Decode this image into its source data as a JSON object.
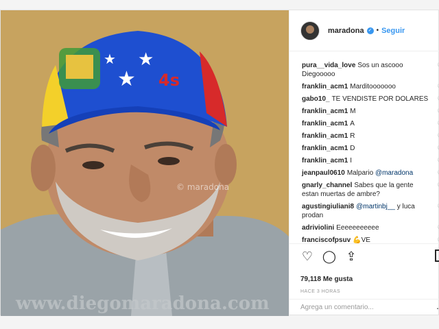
{
  "post": {
    "username": "maradona",
    "follow_label": "Seguir",
    "separator": "•",
    "verified_mark": "✓"
  },
  "photo": {
    "watermark_site": "www.diegomaradona.com",
    "watermark_handle": "© maradona"
  },
  "comments": [
    {
      "user": "pura__vida_love",
      "text": "Sos un ascooo Diegooooo"
    },
    {
      "user": "franklin_acm1",
      "text": "Marditooooooo"
    },
    {
      "user": "gabo10_",
      "text": "TE VENDISTE POR DOLARES"
    },
    {
      "user": "franklin_acm1",
      "text": "M"
    },
    {
      "user": "franklin_acm1",
      "text": "A"
    },
    {
      "user": "franklin_acm1",
      "text": "R"
    },
    {
      "user": "franklin_acm1",
      "text": "D"
    },
    {
      "user": "franklin_acm1",
      "text": "I"
    },
    {
      "user": "jeanpaul0610",
      "text": "Malpario",
      "mention": "@maradona"
    },
    {
      "user": "gnarly_channel",
      "text": "Sabes que la gente estan muertas de ambre?"
    },
    {
      "user": "agustingiuliani8",
      "mention": "@martinbj__",
      "text": "y luca prodan"
    },
    {
      "user": "adriviolini",
      "text": "Eeeeeeeeeee"
    },
    {
      "user": "franciscofpsuv",
      "text": "💪VE"
    }
  ],
  "actions": {
    "like_icon": "♡",
    "comment_icon": "◯",
    "share_icon": "⇪",
    "likes_text": "79,118 Me gusta",
    "time_text": "HACE 3 HORAS",
    "comment_placeholder": "Agrega un comentario...",
    "more_icon": "⋯"
  },
  "colors": {
    "accent": "#3897f0",
    "text": "#262626",
    "muted": "#999999"
  }
}
